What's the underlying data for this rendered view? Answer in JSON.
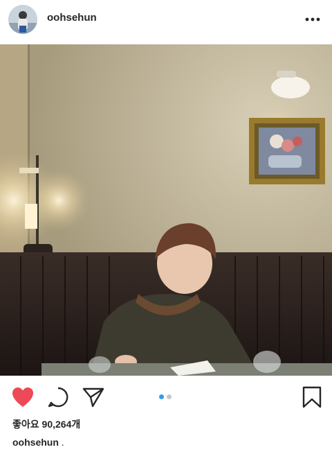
{
  "post": {
    "username": "oohsehun",
    "likes_text": "좋아요 90,264개",
    "caption_user": "oohsehun",
    "caption_text": ".",
    "carousel": {
      "count": 2,
      "active_index": 0
    }
  },
  "icons": {
    "more": "more-horizontal-icon",
    "like": "heart-filled-icon",
    "comment": "comment-bubble-icon",
    "share": "paper-plane-icon",
    "save": "bookmark-icon"
  },
  "colors": {
    "like": "#ed4956",
    "carousel_active": "#3897f0",
    "carousel_inactive": "#c7c7c7",
    "text": "#262626"
  }
}
